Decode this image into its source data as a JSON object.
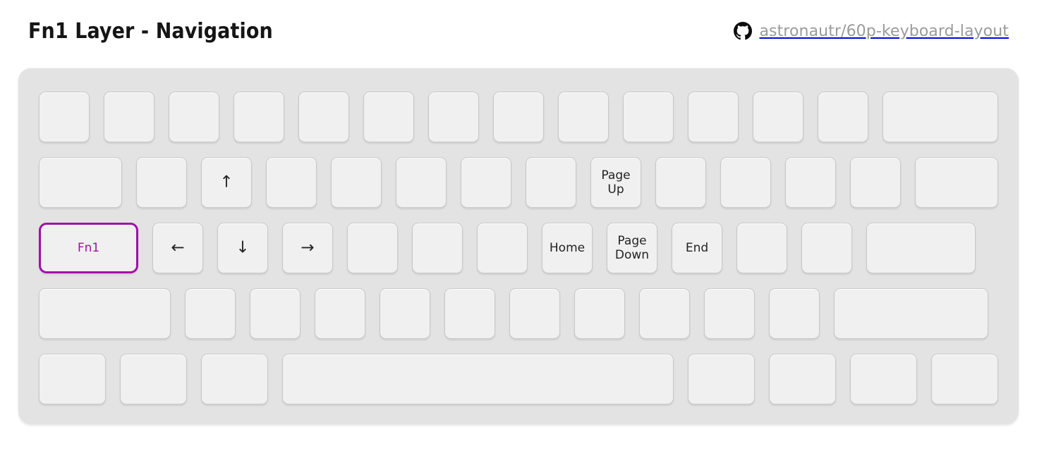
{
  "header": {
    "title": "Fn1 Layer - Navigation",
    "repo": "astronautr/60p-keyboard-layout",
    "github_icon": "github-icon"
  },
  "theme": {
    "background": "#ffffff",
    "case_color": "#e3e3e3",
    "key_color": "#f0f0f0",
    "key_border": "#c9c9c9",
    "key_text": "#232323",
    "accent": "#a010a8",
    "repo_text": "#9a9a9a"
  },
  "keyboard": {
    "layout_name": "60%",
    "rows": [
      {
        "name": "number-row",
        "keys": [
          {
            "label": "",
            "u": 1
          },
          {
            "label": "",
            "u": 1
          },
          {
            "label": "",
            "u": 1
          },
          {
            "label": "",
            "u": 1
          },
          {
            "label": "",
            "u": 1
          },
          {
            "label": "",
            "u": 1
          },
          {
            "label": "",
            "u": 1
          },
          {
            "label": "",
            "u": 1
          },
          {
            "label": "",
            "u": 1
          },
          {
            "label": "",
            "u": 1
          },
          {
            "label": "",
            "u": 1
          },
          {
            "label": "",
            "u": 1
          },
          {
            "label": "",
            "u": 1
          },
          {
            "label": "",
            "u": 2
          }
        ]
      },
      {
        "name": "top-row",
        "keys": [
          {
            "label": "",
            "u": 1.5
          },
          {
            "label": "",
            "u": 1
          },
          {
            "label": "↑",
            "u": 1,
            "kind": "arrow",
            "icon": "arrow-up-icon"
          },
          {
            "label": "",
            "u": 1
          },
          {
            "label": "",
            "u": 1
          },
          {
            "label": "",
            "u": 1
          },
          {
            "label": "",
            "u": 1
          },
          {
            "label": "",
            "u": 1
          },
          {
            "label": "Page\nUp",
            "u": 1
          },
          {
            "label": "",
            "u": 1
          },
          {
            "label": "",
            "u": 1
          },
          {
            "label": "",
            "u": 1
          },
          {
            "label": "",
            "u": 1
          },
          {
            "label": "",
            "u": 1.5
          }
        ]
      },
      {
        "name": "home-row",
        "keys": [
          {
            "label": "Fn1",
            "u": 1.75,
            "active": true
          },
          {
            "label": "←",
            "u": 1,
            "kind": "arrow",
            "icon": "arrow-left-icon"
          },
          {
            "label": "↓",
            "u": 1,
            "kind": "arrow",
            "icon": "arrow-down-icon"
          },
          {
            "label": "→",
            "u": 1,
            "kind": "arrow",
            "icon": "arrow-right-icon"
          },
          {
            "label": "",
            "u": 1
          },
          {
            "label": "",
            "u": 1
          },
          {
            "label": "",
            "u": 1
          },
          {
            "label": "Home",
            "u": 1
          },
          {
            "label": "Page\nDown",
            "u": 1
          },
          {
            "label": "End",
            "u": 1
          },
          {
            "label": "",
            "u": 1
          },
          {
            "label": "",
            "u": 1
          },
          {
            "label": "",
            "u": 1.9
          }
        ]
      },
      {
        "name": "shift-row",
        "keys": [
          {
            "label": "",
            "u": 2.25
          },
          {
            "label": "",
            "u": 1
          },
          {
            "label": "",
            "u": 1
          },
          {
            "label": "",
            "u": 1
          },
          {
            "label": "",
            "u": 1
          },
          {
            "label": "",
            "u": 1
          },
          {
            "label": "",
            "u": 1
          },
          {
            "label": "",
            "u": 1
          },
          {
            "label": "",
            "u": 1
          },
          {
            "label": "",
            "u": 1
          },
          {
            "label": "",
            "u": 1
          },
          {
            "label": "",
            "u": 2.6
          }
        ]
      },
      {
        "name": "bottom-row",
        "keys": [
          {
            "label": "",
            "u": 1.25
          },
          {
            "label": "",
            "u": 1.25
          },
          {
            "label": "",
            "u": 1.25
          },
          {
            "label": "",
            "u": 6.25,
            "name": "spacebar"
          },
          {
            "label": "",
            "u": 1.25
          },
          {
            "label": "",
            "u": 1.25
          },
          {
            "label": "",
            "u": 1.25
          },
          {
            "label": "",
            "u": 1.25
          }
        ]
      }
    ]
  }
}
